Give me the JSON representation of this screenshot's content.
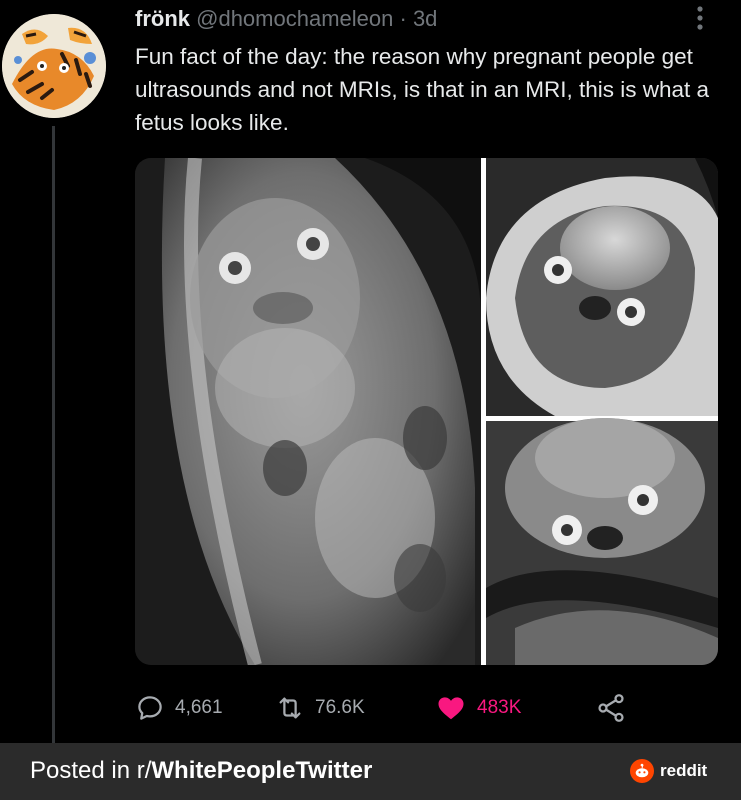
{
  "tweet": {
    "display_name": "frönk",
    "handle": "@dhomochameleon",
    "separator": "·",
    "time": "3d",
    "text": "Fun fact of the day: the reason why pregnant people get ultrasounds and not MRIs, is that in an MRI, this is what a fetus looks like.",
    "avatar_icon": "tiger-illustration-avatar",
    "more_icon": "vertical-dots-icon"
  },
  "actions": {
    "replies": "4,661",
    "retweets": "76.6K",
    "likes": "483K",
    "like_color": "#f91880"
  },
  "footer": {
    "posted_in_prefix": "Posted in r/",
    "subreddit": "WhitePeopleTwitter",
    "brand": "reddit",
    "brand_color": "#ff4500",
    "background": "#2b2b2b"
  }
}
